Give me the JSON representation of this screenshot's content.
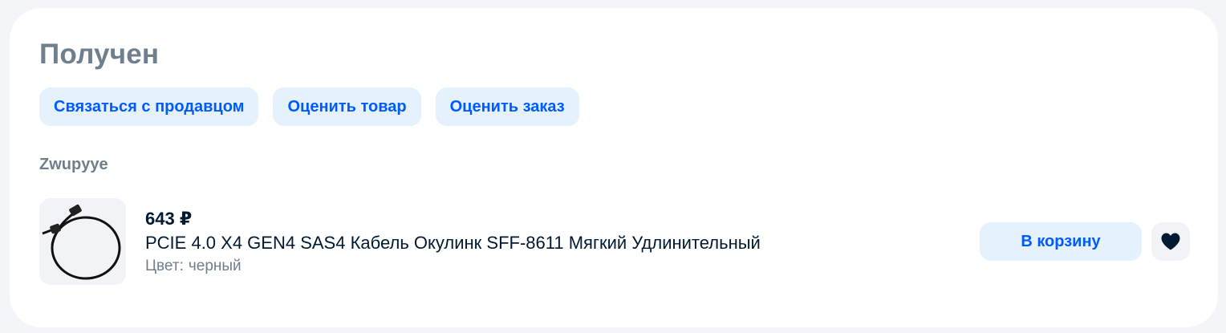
{
  "order": {
    "status": "Получен",
    "actions": [
      {
        "label": "Связаться с продавцом"
      },
      {
        "label": "Оценить товар"
      },
      {
        "label": "Оценить заказ"
      }
    ],
    "seller": "Zwupyye"
  },
  "product": {
    "price": "643 ₽",
    "name": "PCIE 4.0 X4 GEN4 SAS4 Кабель Окулинк SFF-8611 Мягкий Удлинительный",
    "attribute_label": "Цвет:",
    "attribute_value": "черный",
    "image_icon": "cable-image",
    "add_to_cart_label": "В корзину",
    "favorite_icon": "heart-icon"
  },
  "colors": {
    "accent": "#005bff",
    "button_bg": "#e5f1fc",
    "muted_text": "#707f8d",
    "primary_text": "#001a34"
  }
}
